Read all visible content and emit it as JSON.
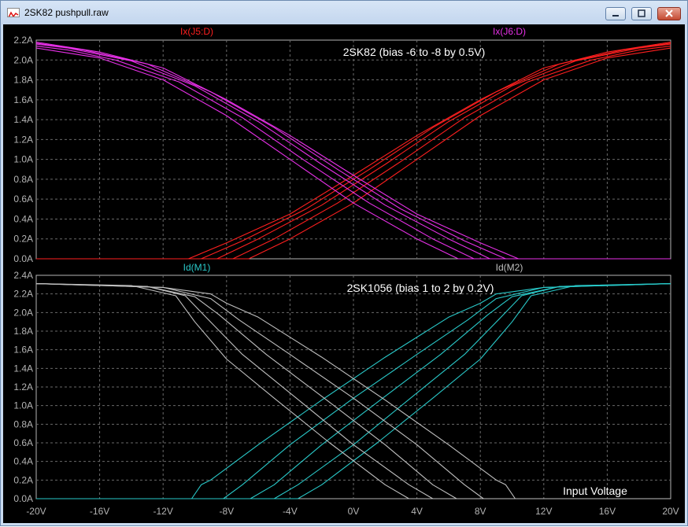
{
  "window": {
    "title": "2SK82 pushpull.raw"
  },
  "colors": {
    "red": "#ff1f1f",
    "magenta": "#e830e8",
    "cyan": "#29c9c9",
    "gray": "#c0c0c0",
    "axis": "#b4b4b4"
  },
  "chart_data": [
    {
      "type": "line",
      "title": "2SK82 (bias -6 to -8 by 0.5V)",
      "xlim": [
        -20,
        20
      ],
      "ylim": [
        0,
        2.2
      ],
      "grid": true,
      "yticks": [
        "0.0A",
        "0.2A",
        "0.4A",
        "0.6A",
        "0.8A",
        "1.0A",
        "1.2A",
        "1.4A",
        "1.6A",
        "1.8A",
        "2.0A",
        "2.2A"
      ],
      "legend": [
        {
          "name": "Ix(J5:D)",
          "color": "#ff1f1f"
        },
        {
          "name": "Ix(J6:D)",
          "color": "#e830e8"
        }
      ],
      "series": [
        {
          "name": "Ix(J5:D)",
          "color": "#ff1f1f",
          "points": [
            [
              [
                -20,
                0
              ],
              [
                -10.4,
                0
              ],
              [
                -8,
                0.16
              ],
              [
                -4,
                0.45
              ],
              [
                0,
                0.84
              ],
              [
                4,
                1.24
              ],
              [
                8,
                1.6
              ],
              [
                12,
                1.92
              ],
              [
                16,
                2.08
              ],
              [
                20,
                2.18
              ]
            ],
            [
              [
                -20,
                0
              ],
              [
                -9.6,
                0
              ],
              [
                -7,
                0.18
              ],
              [
                -3,
                0.5
              ],
              [
                1,
                0.9
              ],
              [
                5,
                1.32
              ],
              [
                9,
                1.68
              ],
              [
                13,
                1.96
              ],
              [
                17,
                2.1
              ],
              [
                20,
                2.17
              ]
            ],
            [
              [
                -20,
                0
              ],
              [
                -8.6,
                0
              ],
              [
                -6,
                0.2
              ],
              [
                -2,
                0.54
              ],
              [
                2,
                0.95
              ],
              [
                6,
                1.38
              ],
              [
                10,
                1.74
              ],
              [
                14,
                1.99
              ],
              [
                18,
                2.12
              ],
              [
                20,
                2.16
              ]
            ],
            [
              [
                -20,
                0
              ],
              [
                -7.6,
                0
              ],
              [
                -5,
                0.2
              ],
              [
                -1,
                0.56
              ],
              [
                3,
                0.98
              ],
              [
                7,
                1.42
              ],
              [
                11,
                1.78
              ],
              [
                15,
                2.0
              ],
              [
                18,
                2.1
              ],
              [
                20,
                2.14
              ]
            ],
            [
              [
                -20,
                0
              ],
              [
                -6.6,
                0
              ],
              [
                -4,
                0.2
              ],
              [
                0,
                0.56
              ],
              [
                4,
                1.0
              ],
              [
                8,
                1.44
              ],
              [
                12,
                1.8
              ],
              [
                16,
                2.02
              ],
              [
                20,
                2.12
              ]
            ]
          ]
        },
        {
          "name": "Ix(J6:D)",
          "color": "#e830e8",
          "points": [
            [
              [
                -20,
                2.18
              ],
              [
                -16,
                2.08
              ],
              [
                -12,
                1.92
              ],
              [
                -8,
                1.6
              ],
              [
                -4,
                1.24
              ],
              [
                0,
                0.84
              ],
              [
                4,
                0.45
              ],
              [
                8,
                0.16
              ],
              [
                10.4,
                0
              ],
              [
                20,
                0
              ]
            ],
            [
              [
                -20,
                2.17
              ],
              [
                -17,
                2.1
              ],
              [
                -13,
                1.96
              ],
              [
                -9,
                1.68
              ],
              [
                -5,
                1.32
              ],
              [
                -1,
                0.9
              ],
              [
                3,
                0.5
              ],
              [
                7,
                0.18
              ],
              [
                9.6,
                0
              ],
              [
                20,
                0
              ]
            ],
            [
              [
                -20,
                2.16
              ],
              [
                -18,
                2.12
              ],
              [
                -14,
                1.99
              ],
              [
                -10,
                1.74
              ],
              [
                -6,
                1.38
              ],
              [
                -2,
                0.95
              ],
              [
                2,
                0.54
              ],
              [
                6,
                0.2
              ],
              [
                8.6,
                0
              ],
              [
                20,
                0
              ]
            ],
            [
              [
                -20,
                2.14
              ],
              [
                -18,
                2.1
              ],
              [
                -15,
                2.0
              ],
              [
                -11,
                1.78
              ],
              [
                -7,
                1.42
              ],
              [
                -3,
                0.98
              ],
              [
                1,
                0.56
              ],
              [
                5,
                0.2
              ],
              [
                7.6,
                0
              ],
              [
                20,
                0
              ]
            ],
            [
              [
                -20,
                2.12
              ],
              [
                -16,
                2.02
              ],
              [
                -12,
                1.8
              ],
              [
                -8,
                1.44
              ],
              [
                -4,
                1.0
              ],
              [
                0,
                0.56
              ],
              [
                4,
                0.2
              ],
              [
                6.6,
                0
              ],
              [
                20,
                0
              ]
            ]
          ]
        }
      ]
    },
    {
      "type": "line",
      "title": "2SK1056  (bias 1 to 2 by 0.2V)",
      "xlim": [
        -20,
        20
      ],
      "ylim": [
        0,
        2.4
      ],
      "grid": true,
      "yticks": [
        "0.0A",
        "0.2A",
        "0.4A",
        "0.6A",
        "0.8A",
        "1.0A",
        "1.2A",
        "1.4A",
        "1.6A",
        "1.8A",
        "2.0A",
        "2.2A",
        "2.4A"
      ],
      "xticks": [
        "-20V",
        "-16V",
        "-12V",
        "-8V",
        "-4V",
        "0V",
        "4V",
        "8V",
        "12V",
        "16V",
        "20V"
      ],
      "xlabel": "Input Voltage",
      "legend": [
        {
          "name": "Id(M1)",
          "color": "#29c9c9"
        },
        {
          "name": "Id(M2)",
          "color": "#c0c0c0"
        }
      ],
      "series": [
        {
          "name": "Id(M1)",
          "color": "#29c9c9",
          "points": [
            [
              [
                -20,
                0
              ],
              [
                -10.2,
                0
              ],
              [
                -9.6,
                0.15
              ],
              [
                -9,
                0.2
              ],
              [
                -6,
                0.58
              ],
              [
                -2,
                1.06
              ],
              [
                2,
                1.52
              ],
              [
                6,
                1.95
              ],
              [
                8,
                2.1
              ],
              [
                9,
                2.2
              ],
              [
                12,
                2.27
              ],
              [
                20,
                2.31
              ]
            ],
            [
              [
                -20,
                0
              ],
              [
                -8.2,
                0
              ],
              [
                -7,
                0.15
              ],
              [
                -4,
                0.58
              ],
              [
                0,
                1.08
              ],
              [
                4,
                1.55
              ],
              [
                7.2,
                1.92
              ],
              [
                9,
                2.15
              ],
              [
                12,
                2.27
              ],
              [
                20,
                2.31
              ]
            ],
            [
              [
                -20,
                0
              ],
              [
                -6.5,
                0
              ],
              [
                -5,
                0.15
              ],
              [
                -2,
                0.58
              ],
              [
                2,
                1.1
              ],
              [
                5.5,
                1.55
              ],
              [
                8.5,
                1.98
              ],
              [
                10,
                2.17
              ],
              [
                13,
                2.28
              ],
              [
                20,
                2.31
              ]
            ],
            [
              [
                -20,
                0
              ],
              [
                -5,
                0
              ],
              [
                -3.5,
                0.15
              ],
              [
                0,
                0.58
              ],
              [
                3.6,
                1.08
              ],
              [
                7,
                1.55
              ],
              [
                9.3,
                1.95
              ],
              [
                10.6,
                2.18
              ],
              [
                13,
                2.28
              ],
              [
                20,
                2.31
              ]
            ],
            [
              [
                -20,
                0
              ],
              [
                -3.5,
                0
              ],
              [
                -2,
                0.15
              ],
              [
                1.5,
                0.6
              ],
              [
                5,
                1.08
              ],
              [
                8,
                1.5
              ],
              [
                10,
                1.9
              ],
              [
                11.2,
                2.18
              ],
              [
                14,
                2.29
              ],
              [
                20,
                2.31
              ]
            ]
          ]
        },
        {
          "name": "Id(M2)",
          "color": "#c0c0c0",
          "points": [
            [
              [
                -20,
                2.31
              ],
              [
                -12,
                2.27
              ],
              [
                -9,
                2.2
              ],
              [
                -8,
                2.1
              ],
              [
                -6,
                1.95
              ],
              [
                -2,
                1.52
              ],
              [
                2,
                1.06
              ],
              [
                6,
                0.58
              ],
              [
                9,
                0.2
              ],
              [
                9.6,
                0.15
              ],
              [
                10.2,
                0
              ],
              [
                20,
                0
              ]
            ],
            [
              [
                -20,
                2.31
              ],
              [
                -12,
                2.27
              ],
              [
                -9,
                2.15
              ],
              [
                -7.2,
                1.92
              ],
              [
                -4,
                1.55
              ],
              [
                0,
                1.08
              ],
              [
                4,
                0.58
              ],
              [
                7,
                0.15
              ],
              [
                8.2,
                0
              ],
              [
                20,
                0
              ]
            ],
            [
              [
                -20,
                2.31
              ],
              [
                -13,
                2.28
              ],
              [
                -10,
                2.17
              ],
              [
                -8.5,
                1.98
              ],
              [
                -5.5,
                1.55
              ],
              [
                -2,
                1.1
              ],
              [
                2,
                0.58
              ],
              [
                5,
                0.15
              ],
              [
                6.5,
                0
              ],
              [
                20,
                0
              ]
            ],
            [
              [
                -20,
                2.31
              ],
              [
                -13,
                2.28
              ],
              [
                -10.6,
                2.18
              ],
              [
                -9.3,
                1.95
              ],
              [
                -7,
                1.55
              ],
              [
                -3.6,
                1.08
              ],
              [
                0,
                0.58
              ],
              [
                3.5,
                0.15
              ],
              [
                5,
                0
              ],
              [
                20,
                0
              ]
            ],
            [
              [
                -20,
                2.31
              ],
              [
                -14,
                2.29
              ],
              [
                -11.2,
                2.18
              ],
              [
                -10,
                1.9
              ],
              [
                -8,
                1.5
              ],
              [
                -5,
                1.08
              ],
              [
                -1.5,
                0.6
              ],
              [
                2,
                0.15
              ],
              [
                3.5,
                0
              ],
              [
                20,
                0
              ]
            ]
          ]
        }
      ]
    }
  ]
}
